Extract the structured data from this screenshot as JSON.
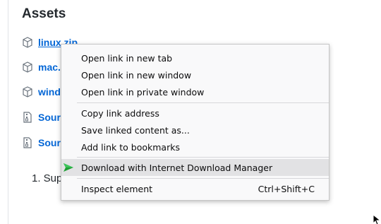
{
  "assets": {
    "heading": "Assets",
    "items": [
      {
        "label": "linux.zip",
        "icon": "package-icon"
      },
      {
        "label": "mac.",
        "icon": "package-icon"
      },
      {
        "label": "wind",
        "icon": "package-icon"
      },
      {
        "label": "Sour",
        "icon": "file-zip-icon"
      },
      {
        "label": "Sour",
        "icon": "file-zip-icon"
      }
    ]
  },
  "content": {
    "list_item": "1. Sup"
  },
  "context_menu": {
    "open_new_tab": "Open link in new tab",
    "open_new_window": "Open link in new window",
    "open_private_window": "Open link in private window",
    "copy_link": "Copy link address",
    "save_linked": "Save linked content as...",
    "add_bookmark": "Add link to bookmarks",
    "idm_download": "Download with Internet Download Manager",
    "inspect": "Inspect element",
    "inspect_shortcut": "Ctrl+Shift+C"
  },
  "colors": {
    "link": "#0366d6",
    "menu_bg": "#f9f9fa",
    "menu_highlight": "#e2e2e4",
    "idm_green": "#1f9e35"
  }
}
